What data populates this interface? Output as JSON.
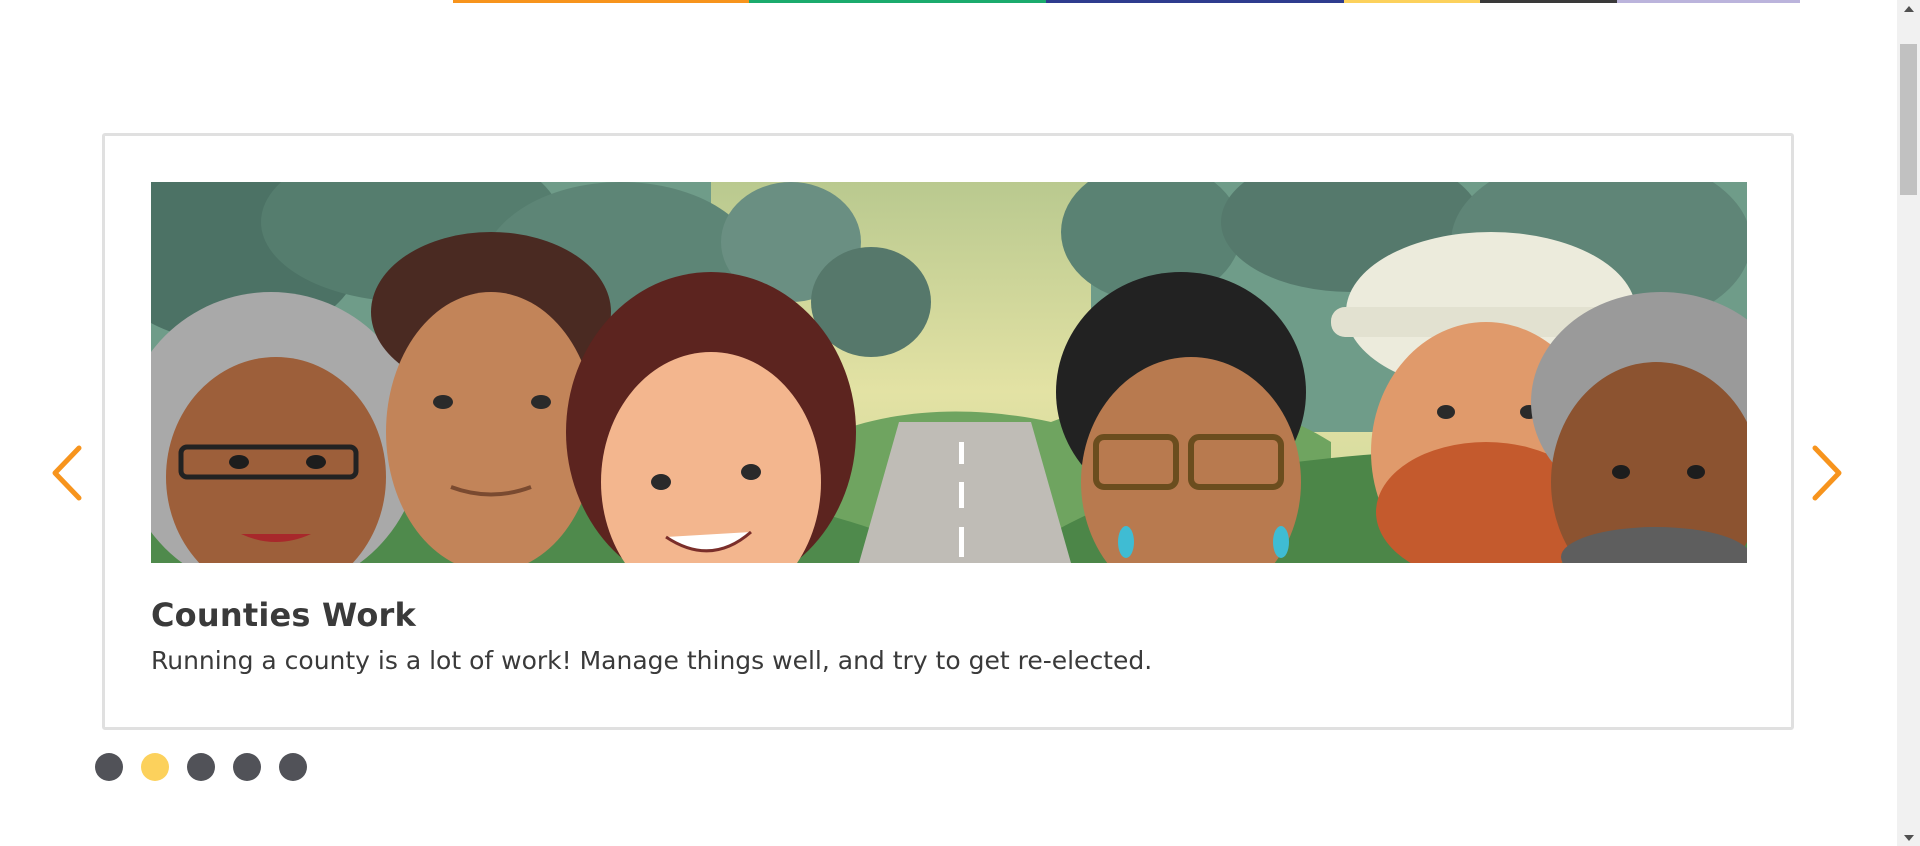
{
  "stripe": {
    "colors": [
      "#f7941d",
      "#1bab6d",
      "#2e3c8e",
      "#fcd15c",
      "#3a3a3a",
      "#bbb4dc"
    ]
  },
  "carousel": {
    "slide": {
      "title": "Counties Work",
      "description": "Running a county is a lot of work! Manage things well, and try to get re-elected.",
      "image": "illustrated group of county officials standing on a road through green hills"
    },
    "prev_icon": "chevron-left-icon",
    "next_icon": "chevron-right-icon",
    "arrow_color": "#f7941d",
    "dots": {
      "count": 5,
      "active_index": 1,
      "active_color": "#fcd15c",
      "inactive_color": "#515258"
    }
  }
}
